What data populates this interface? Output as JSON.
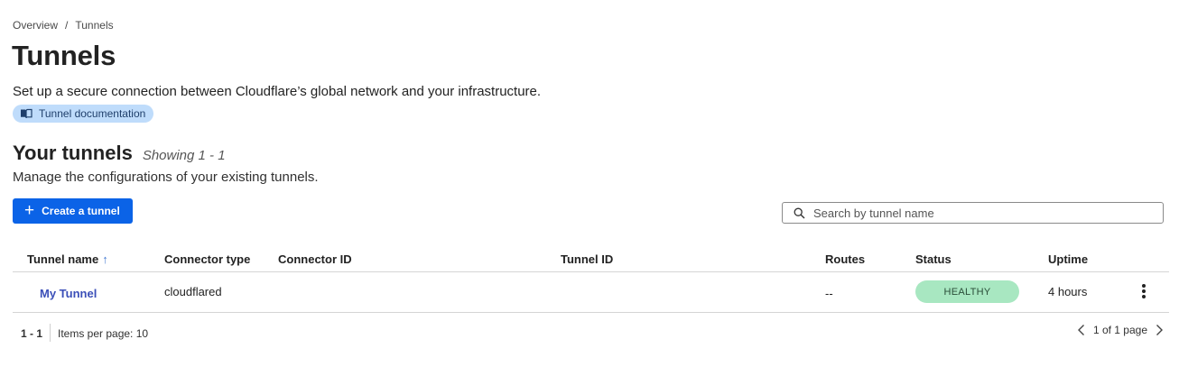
{
  "breadcrumb": {
    "root": "Overview",
    "separator": "/",
    "current": "Tunnels"
  },
  "page": {
    "title": "Tunnels",
    "description": "Set up a secure connection between Cloudflare’s global network and your infrastructure.",
    "doc_link": "Tunnel documentation"
  },
  "section": {
    "title": "Your tunnels",
    "showing": "Showing 1 - 1",
    "description": "Manage the configurations of your existing tunnels.",
    "create_label": "Create a tunnel"
  },
  "search": {
    "placeholder": "Search by tunnel name",
    "value": ""
  },
  "table": {
    "columns": [
      "Tunnel name",
      "Connector type",
      "Connector ID",
      "Tunnel ID",
      "Routes",
      "Status",
      "Uptime"
    ],
    "sort_icon": "arrow-up-icon",
    "rows": [
      {
        "name": "My Tunnel",
        "connector_type": "cloudflared",
        "connector_id": "",
        "tunnel_id": "",
        "routes": "--",
        "status": "HEALTHY",
        "uptime": "4 hours"
      }
    ]
  },
  "footer": {
    "range": "1 - 1",
    "items_per_page": "Items per page: 10",
    "page_info": "1 of 1 page"
  },
  "colors": {
    "primary": "#0b63e7",
    "healthy_bg": "#a8e7c1",
    "doc_pill_bg": "#bfdcfb",
    "link": "#3b4fb8"
  }
}
